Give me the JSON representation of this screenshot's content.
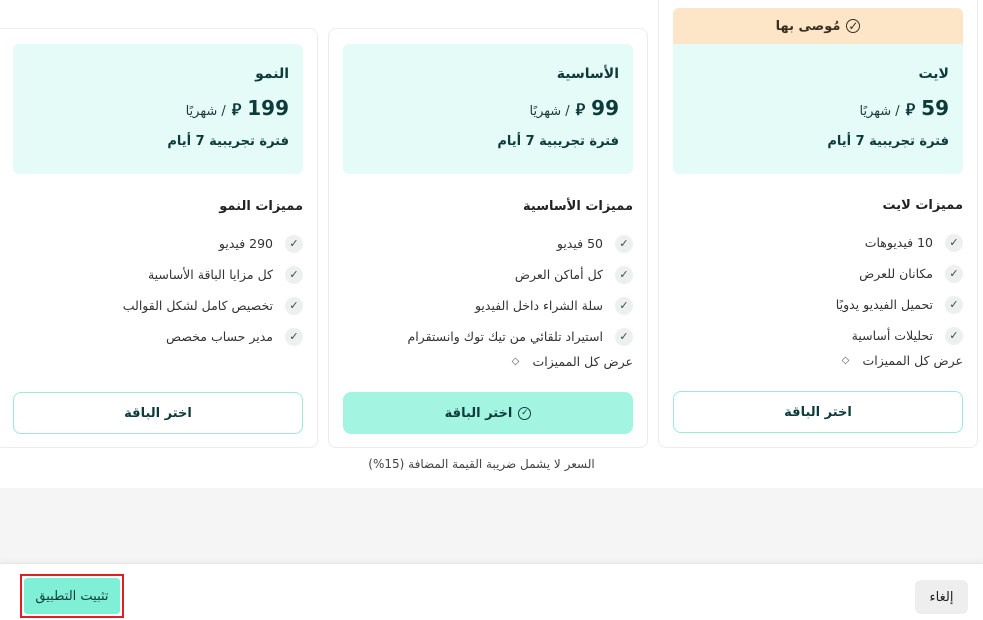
{
  "plans": {
    "lite": {
      "badge": "مُوصى بها",
      "name": "لايت",
      "price_amount": "59",
      "currency_symbol": "⃁",
      "price_period": "/ شهريًا",
      "trial": "فترة تجريبية 7 أيام",
      "features_title": "مميزات لايت",
      "features": [
        "10 فيديوهات",
        "مكانان للعرض",
        "تحميل الفيديو يدويًا",
        "تحليلات أساسية"
      ],
      "show_all": "عرض كل المميزات",
      "cta": "اختر الباقة"
    },
    "basic": {
      "name": "الأساسية",
      "price_amount": "99",
      "currency_symbol": "⃁",
      "price_period": "/ شهريًا",
      "trial": "فترة تجريبية 7 أيام",
      "features_title": "مميزات الأساسية",
      "features": [
        "50 فيديو",
        "كل أماكن العرض",
        "سلة الشراء داخل الفيديو",
        "استيراد تلقائي من تيك توك وانستقرام"
      ],
      "show_all": "عرض كل المميزات",
      "cta": "اختر الباقة"
    },
    "growth": {
      "name": "النمو",
      "price_amount": "199",
      "currency_symbol": "⃁",
      "price_period": "/ شهريًا",
      "trial": "فترة تجريبية 7 أيام",
      "features_title": "مميزات النمو",
      "features": [
        "290 فيديو",
        "كل مزايا الباقة الأساسية",
        "تخصيص كامل لشكل القوالب",
        "مدير حساب مخصص"
      ],
      "cta": "اختر الباقة"
    }
  },
  "vat_note": "السعر لا يشمل ضريبة القيمة المضافة (15%)",
  "footer": {
    "install_label": "تثبيت التطبيق",
    "cancel_label": "إلغاء"
  },
  "icons": {
    "check": "✓",
    "badge": "check-circle-icon",
    "expand": "chevron-up-down-icon"
  },
  "colors": {
    "accent": "#7ff0d6",
    "card_head": "#e4fbf7",
    "badge_bg": "#fde6c7",
    "highlight_border": "#e02020"
  }
}
